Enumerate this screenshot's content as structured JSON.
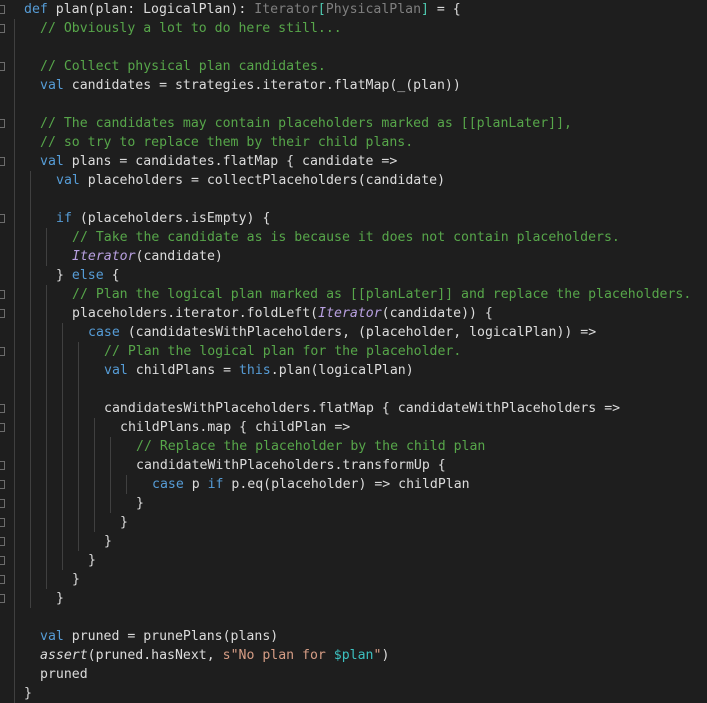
{
  "editor": {
    "language": "Scala",
    "lines": [
      [
        [
          "kw",
          "def "
        ],
        [
          "",
          "plan(plan: LogicalPlan): "
        ],
        [
          "gr",
          "Iterator"
        ],
        [
          "ty",
          "["
        ],
        [
          "gr",
          "PhysicalPlan"
        ],
        [
          "ty",
          "]"
        ],
        [
          "",
          " = {"
        ]
      ],
      [
        [
          "cm",
          "// Obviously a lot to do here still..."
        ]
      ],
      [],
      [
        [
          "cm",
          "// Collect physical plan candidates."
        ]
      ],
      [
        [
          "kw",
          "val "
        ],
        [
          "",
          "candidates = strategies.iterator.flatMap(_(plan))"
        ]
      ],
      [],
      [
        [
          "cm",
          "// The candidates may contain placeholders marked as [[planLater]],"
        ]
      ],
      [
        [
          "cm",
          "// so try to replace them by their child plans."
        ]
      ],
      [
        [
          "kw",
          "val "
        ],
        [
          "",
          "plans = candidates.flatMap { candidate =>"
        ]
      ],
      [
        [
          "kw",
          "val "
        ],
        [
          "",
          "placeholders = collectPlaceholders(candidate)"
        ]
      ],
      [],
      [
        [
          "kw",
          "if "
        ],
        [
          "",
          "(placeholders.isEmpty) {"
        ]
      ],
      [
        [
          "cm",
          "// Take the candidate as is because it does not contain placeholders."
        ]
      ],
      [
        [
          "it",
          "Iterator"
        ],
        [
          "",
          "(candidate)"
        ]
      ],
      [
        [
          "",
          "} "
        ],
        [
          "kw",
          "else "
        ],
        [
          "",
          "{"
        ]
      ],
      [
        [
          "cm",
          "// Plan the logical plan marked as [[planLater]] and replace the placeholders."
        ]
      ],
      [
        [
          "",
          "placeholders.iterator.foldLeft("
        ],
        [
          "it",
          "Iterator"
        ],
        [
          "",
          "(candidate)) {"
        ]
      ],
      [
        [
          "kw",
          "case "
        ],
        [
          "",
          "(candidatesWithPlaceholders, (placeholder, logicalPlan)) =>"
        ]
      ],
      [
        [
          "cm",
          "// Plan the logical plan for the placeholder."
        ]
      ],
      [
        [
          "kw",
          "val "
        ],
        [
          "",
          "childPlans = "
        ],
        [
          "kw",
          "this"
        ],
        [
          "",
          ".plan(logicalPlan)"
        ]
      ],
      [],
      [
        [
          "",
          "candidatesWithPlaceholders.flatMap { candidateWithPlaceholders =>"
        ]
      ],
      [
        [
          "",
          "childPlans.map { childPlan =>"
        ]
      ],
      [
        [
          "cm",
          "// Replace the placeholder by the child plan"
        ]
      ],
      [
        [
          "",
          "candidateWithPlaceholders.transformUp {"
        ]
      ],
      [
        [
          "kw",
          "case "
        ],
        [
          "",
          "p "
        ],
        [
          "kw",
          "if "
        ],
        [
          "",
          "p.eq(placeholder) => childPlan"
        ]
      ],
      [
        [
          "",
          "}"
        ]
      ],
      [
        [
          "",
          "}"
        ]
      ],
      [
        [
          "",
          "}"
        ]
      ],
      [
        [
          "",
          "}"
        ]
      ],
      [
        [
          "",
          "}"
        ]
      ],
      [
        [
          "",
          "}"
        ]
      ],
      [],
      [
        [
          "kw",
          "val "
        ],
        [
          "",
          "pruned = prunePlans(plans)"
        ]
      ],
      [
        [
          "fn",
          "assert"
        ],
        [
          "",
          "(pruned.hasNext, "
        ],
        [
          "st",
          "s\"No plan for "
        ],
        [
          "ip",
          "$plan"
        ],
        [
          "st",
          "\""
        ],
        [
          "",
          ")"
        ]
      ],
      [
        [
          "",
          "pruned"
        ]
      ],
      [
        [
          "",
          "}"
        ]
      ]
    ]
  }
}
